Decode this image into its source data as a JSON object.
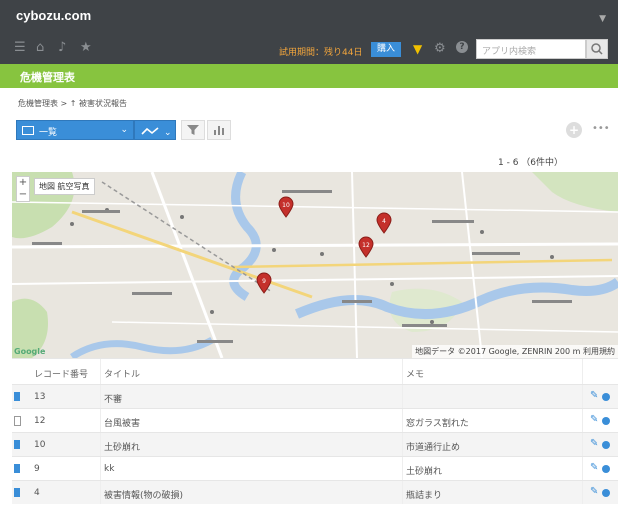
{
  "header": {
    "brand": "cybozu.com",
    "trial_text": "試用期間：残り44日",
    "buy_label": "購入",
    "search_placeholder": "アプリ内検索",
    "icons": [
      "menu-icon",
      "home-icon",
      "bell-icon",
      "star-icon",
      "badge-icon",
      "gear-icon",
      "help-icon",
      "search-icon"
    ]
  },
  "app": {
    "name": "危機管理表"
  },
  "breadcrumb": "危機管理表 > ↑ 被害状況報告",
  "toolbar": {
    "view_label": "一覧",
    "graph_icon": "chart-line-icon",
    "filter_icon": "filter-icon",
    "graph_bar_icon": "bar-chart-icon"
  },
  "pagination": "1 - 6 （6件中）",
  "map": {
    "type_buttons": [
      "地図",
      "航空写真"
    ],
    "credit": "地図データ ©2017 Google, ZENRIN 200 m 利用規約",
    "google_label": "Google",
    "markers": [
      "10",
      "4",
      "12",
      "9"
    ]
  },
  "table": {
    "columns": [
      "レコード番号",
      "タイトル",
      "メモ"
    ],
    "rows": [
      {
        "id": "13",
        "title": "不審",
        "memo": "",
        "icon": "doc-blue"
      },
      {
        "id": "12",
        "title": "台風被害",
        "memo": "窓ガラス割れた",
        "icon": "doc-outline"
      },
      {
        "id": "10",
        "title": "土砂崩れ",
        "memo": "市道通行止め",
        "icon": "doc-blue"
      },
      {
        "id": "9",
        "title": "kk",
        "memo": "土砂崩れ",
        "icon": "doc-blue"
      },
      {
        "id": "4",
        "title": "被害情報(物の破損)",
        "memo": "瓶詰まり",
        "icon": "doc-blue"
      }
    ]
  },
  "colors": {
    "topbar": "#3f4347",
    "appbar": "#87c43f",
    "accent": "#3a8ed8",
    "trial": "#f0a43c",
    "marker": "#c4302b"
  }
}
